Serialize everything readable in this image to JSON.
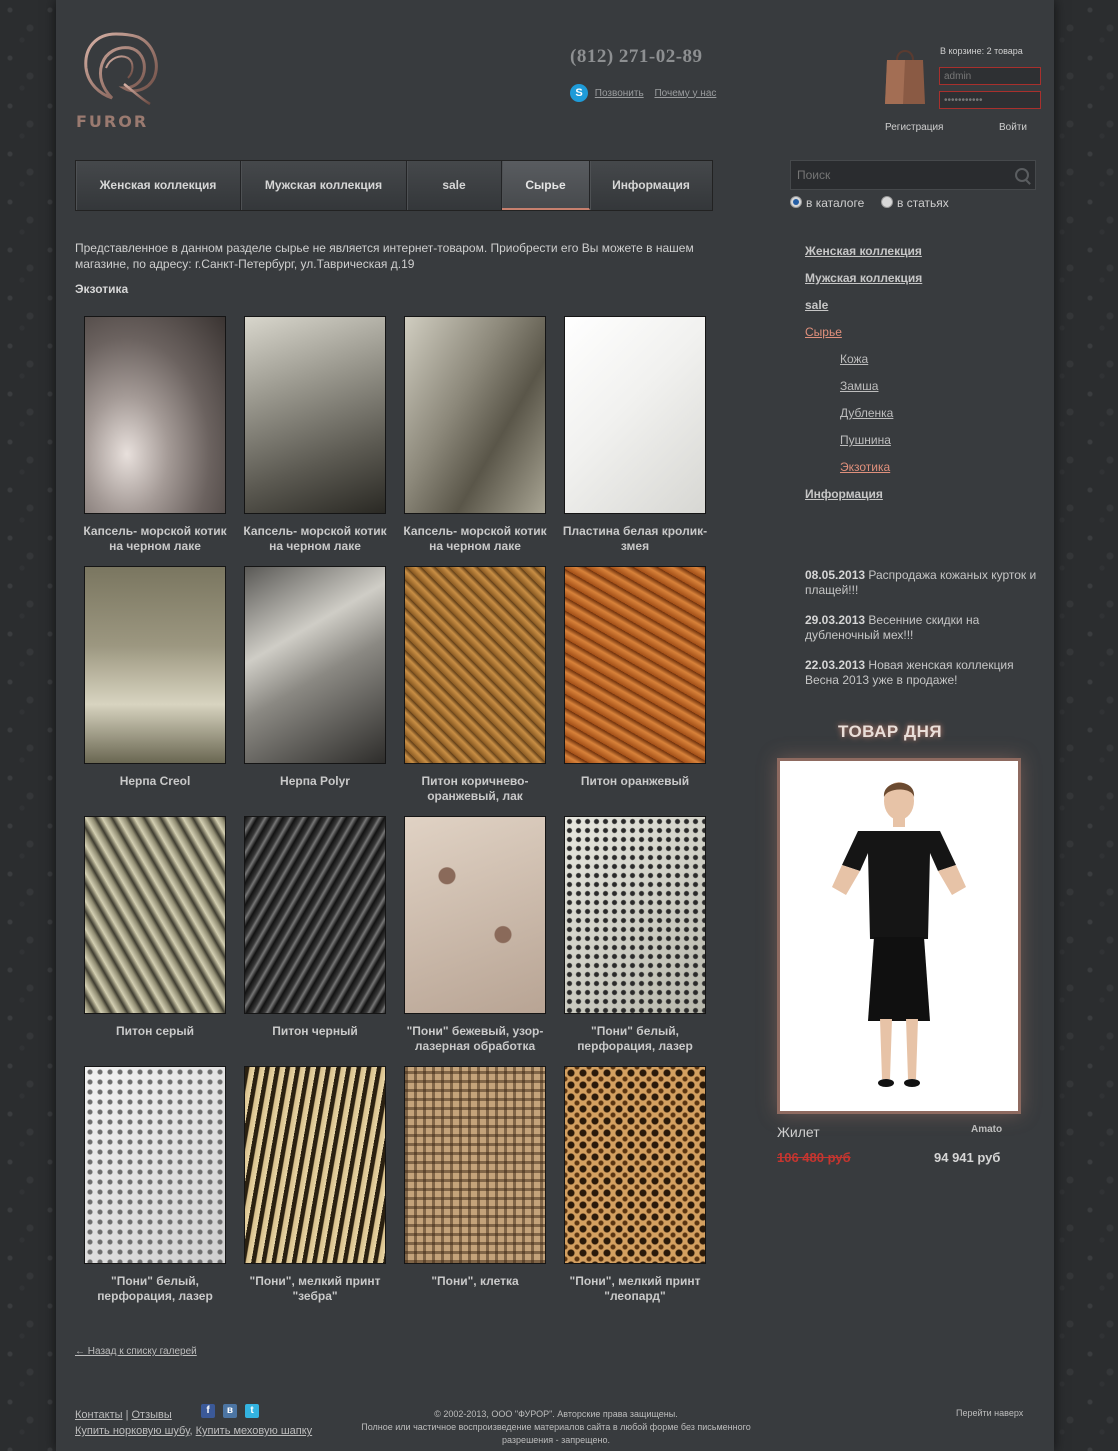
{
  "header": {
    "logo_text": "FUROR",
    "phone": "(812) 271-02-89",
    "skype_call": "Позвонить",
    "why_us": "Почему у нас",
    "cart_text": "В корзине: 2 товара",
    "login_value": "admin",
    "password_value": "•••••••••••",
    "register": "Регистрация",
    "login_button": "Войти"
  },
  "nav": {
    "items": [
      "Женская коллекция",
      "Мужская коллекция",
      "sale",
      "Сырье",
      "Информация"
    ],
    "active_index": 3
  },
  "search": {
    "placeholder": "Поиск",
    "opt_catalog": "в каталоге",
    "opt_articles": "в статьях"
  },
  "content": {
    "intro": "Представленное в данном разделе сырье не является интернет-товаром. Приобрести его Вы можете в нашем магазине, по адресу: г.Санкт-Петербург, ул.Таврическая д.19",
    "section_title": "Экзотика",
    "gallery": [
      "Капсель- морской котик на черном лаке",
      "Капсель- морской котик на черном лаке",
      "Капсель- морской котик на черном лаке",
      "Пластина белая кролик-змея",
      "Нерпа Creol",
      "Нерпа Polyr",
      "Питон коричнево-оранжевый, лак",
      "Питон оранжевый",
      "Питон серый",
      "Питон черный",
      "\"Пони\" бежевый, узор-лазерная обработка",
      "\"Пони\" белый, перфорация, лазер",
      "\"Пони\" белый, перфорация, лазер",
      "\"Пони\", мелкий принт \"зебра\"",
      "\"Пони\", клетка",
      "\"Пони\", мелкий принт \"леопард\""
    ],
    "back_link": "← Назад к списку галерей"
  },
  "sidebar": {
    "menu": {
      "women": "Женская коллекция",
      "men": "Мужская коллекция",
      "sale": "sale",
      "raw": "Сырье",
      "leather": "Кожа",
      "suede": "Замша",
      "sheepskin": "Дубленка",
      "fur": "Пушнина",
      "exotic": "Экзотика",
      "info": "Информация"
    },
    "news": [
      {
        "date": "08.05.2013",
        "text": "Распродажа кожаных курток и плащей!!!"
      },
      {
        "date": "29.03.2013",
        "text": "Весенние скидки на дубленочный мех!!!"
      },
      {
        "date": "22.03.2013",
        "text": "Новая женская коллекция Весна 2013 уже в продаже!"
      }
    ],
    "product_of_day": {
      "title": "ТОВАР ДНЯ",
      "name": "Жилет",
      "brand": "Amato",
      "old_price": "106 480 руб",
      "new_price": "94 941 руб"
    }
  },
  "footer": {
    "contacts": "Контакты",
    "sep": "|",
    "reviews": "Отзывы",
    "mink": "Купить норковую шубу",
    "comma": ",",
    "hat": "Купить меховую шапку",
    "copyright1": "© 2002-2013, ООО \"ФУРОР\". Авторские права защищены.",
    "copyright2": "Полное или частичное воспроизведение материалов сайта в любой форме без письменного разрешения - запрещено.",
    "to_top": "Перейти наверх",
    "social_fb": "f",
    "social_vk": "в",
    "social_tw": "t"
  },
  "colors": {
    "accent": "#c7806e",
    "price_old": "#c5352f",
    "page_bg": "#383b3e"
  }
}
